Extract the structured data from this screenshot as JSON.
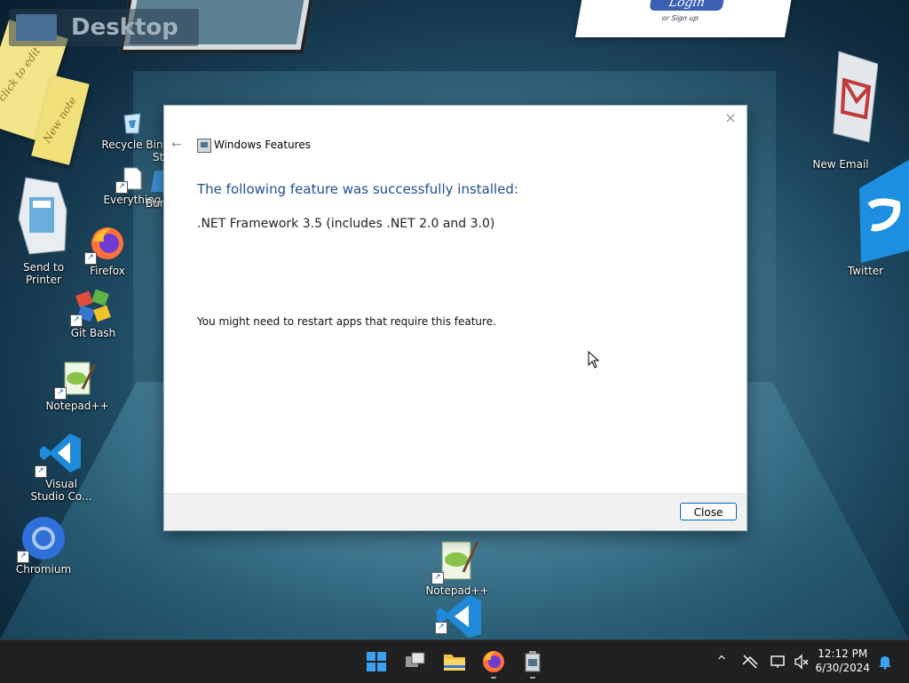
{
  "desktop": {
    "corner_label": "Desktop",
    "login_card": {
      "login": "Login",
      "signup": "or Sign up"
    },
    "sticky_notes": [
      "click to edit",
      "New note"
    ],
    "icons": {
      "recycle_bin": "Recycle Bin",
      "everything": "Everything",
      "everything_cut": "Bur",
      "send_to_printer": "Send to\nPrinter",
      "firefox": "Firefox",
      "git_bash": "Git Bash",
      "notepadpp": "Notepad++",
      "vscode": "Visual\nStudio Co...",
      "chromium": "Chromium",
      "new_email": "New Email",
      "twitter": "Twitter",
      "notepadpp_center": "Notepad++"
    }
  },
  "dialog": {
    "title": "Windows Features",
    "heading": "The following feature was successfully installed:",
    "feature": ".NET Framework 3.5 (includes .NET 2.0 and 3.0)",
    "note": "You might need to restart apps that require this feature.",
    "close_button": "Close",
    "close_glyph": "×",
    "back_glyph": "←"
  },
  "taskbar": {
    "time": "12:12 PM",
    "date": "6/30/2024",
    "tray_chevron": "^"
  },
  "colors": {
    "heading_blue": "#1f4f8f",
    "accent": "#0067c0",
    "taskbar": "#202020"
  }
}
